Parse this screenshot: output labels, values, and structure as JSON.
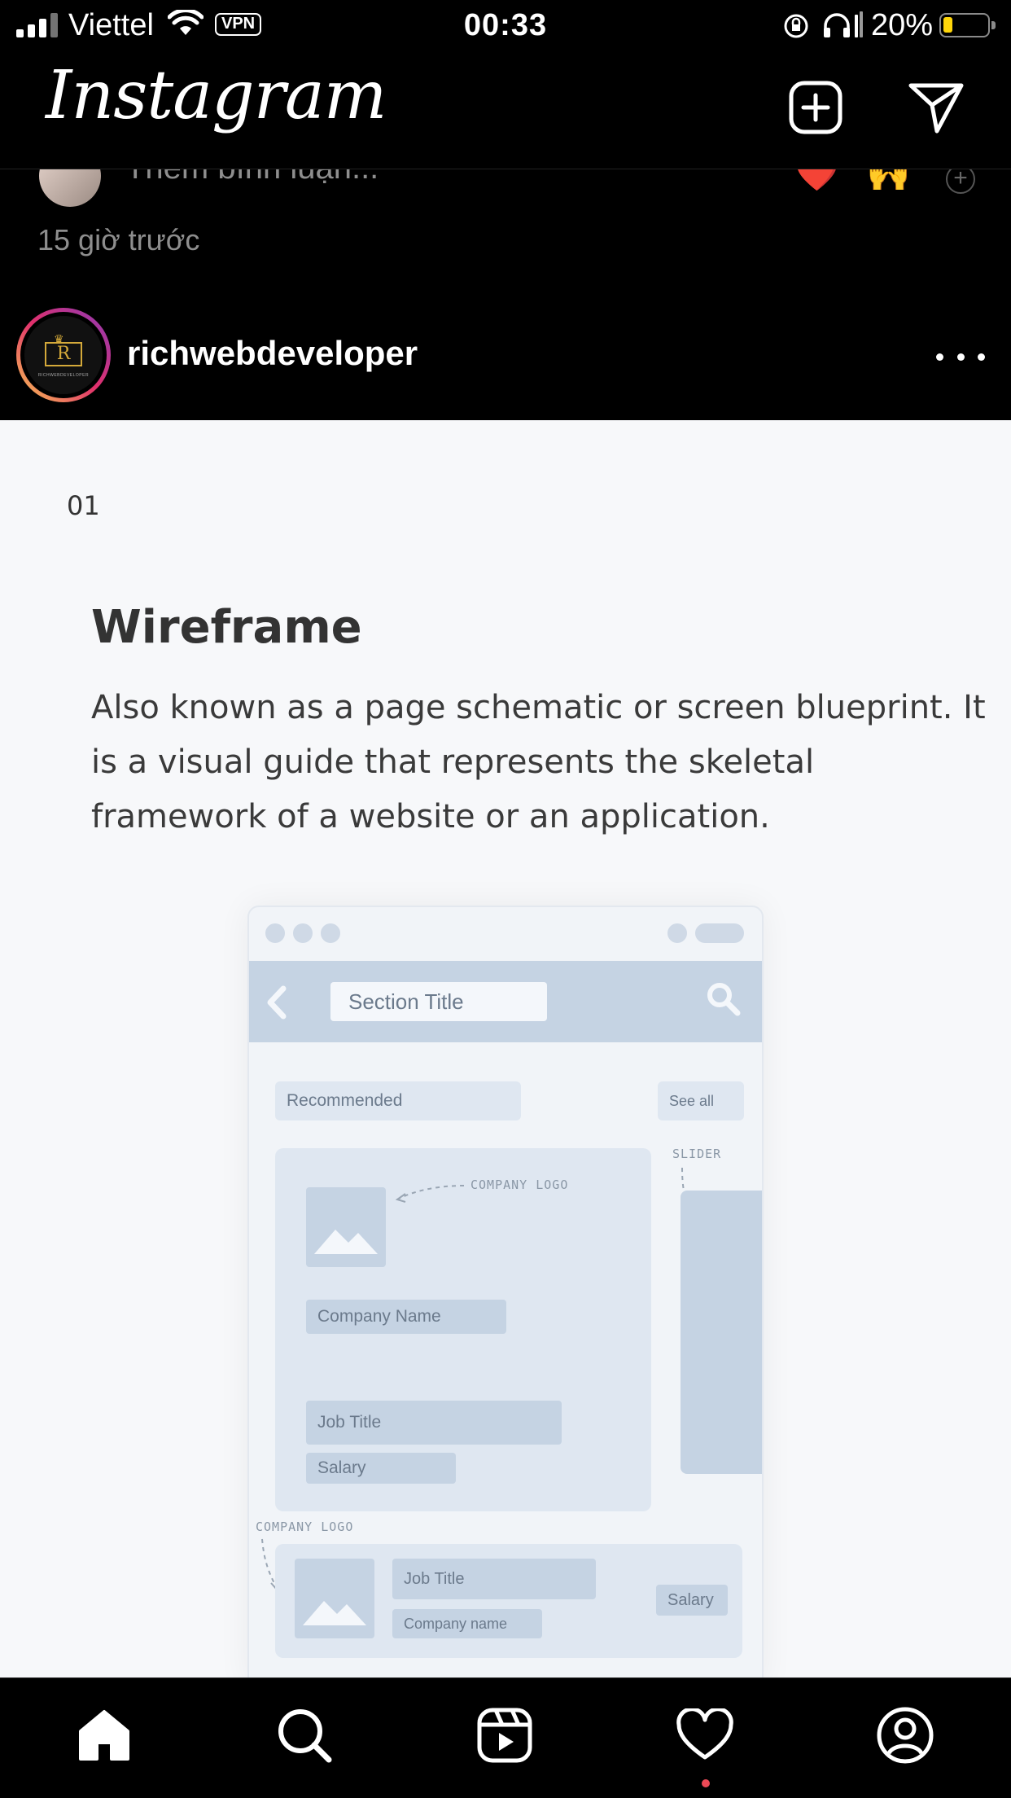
{
  "status_bar": {
    "carrier": "Viettel",
    "vpn": "VPN",
    "time": "00:33",
    "battery_percent": "20%",
    "battery_level": 0.2,
    "battery_color": "#ffd60a"
  },
  "header": {
    "app_title": "Instagram",
    "icons": [
      "plus-square-icon",
      "paper-plane-icon"
    ]
  },
  "previous_post": {
    "add_comment_placeholder": "Thêm bình luận...",
    "reactions": [
      "❤️",
      "🙌"
    ],
    "time_ago": "15 giờ trước"
  },
  "post": {
    "username": "richwebdeveloper",
    "avatar": {
      "letter": "R",
      "caption": "RICHWEBDEVELOPER"
    },
    "slide": {
      "number": "01",
      "title": "Wireframe",
      "body": "Also known as a page schematic or screen blueprint. It is a visual guide that represents the skeletal framework of a website or an application.",
      "wireframe": {
        "section_title": "Section Title",
        "recommended": "Recommended",
        "see_all": "See all",
        "slider_note": "SLIDER",
        "company_logo_note": "COMPANY LOGO",
        "company_name": "Company Name",
        "job_title": "Job Title",
        "salary": "Salary",
        "row_logo_note": "COMPANY LOGO",
        "row_job_title": "Job Title",
        "row_company_name": "Company name",
        "row_salary": "Salary"
      }
    }
  },
  "tab_bar": {
    "tabs": [
      "home-icon",
      "search-icon",
      "reels-icon",
      "activity-heart-icon",
      "profile-icon"
    ],
    "active": "home",
    "notification_color": "#ed4956"
  }
}
